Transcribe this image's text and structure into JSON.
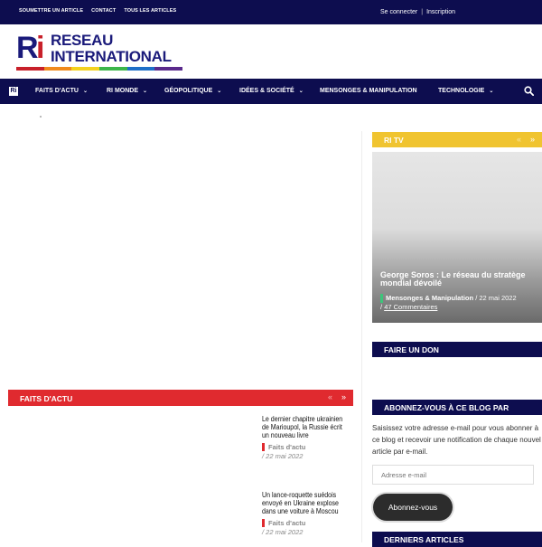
{
  "topbar": {
    "links": [
      "SOUMETTRE UN ARTICLE",
      "CONTACT",
      "TOUS LES ARTICLES"
    ],
    "login": "Se connecter",
    "separator": "|",
    "register": "Inscription"
  },
  "logo": {
    "mark_r": "R",
    "mark_i": "i",
    "line1": "RESEAU",
    "line2": "INTERNATIONAL",
    "stripe_colors": [
      "#c8202a",
      "#f08a1c",
      "#f4d21e",
      "#3cb64a",
      "#1e6fc8",
      "#5a2a8c"
    ]
  },
  "nav": {
    "home_label": "Ri",
    "items": [
      {
        "label": "FAITS D'ACTU",
        "chevron": "⌄"
      },
      {
        "label": "RI MONDE",
        "chevron": "⌄"
      },
      {
        "label": "GÉOPOLITIQUE",
        "chevron": "⌄"
      },
      {
        "label": "IDÉES & SOCIÉTÉ",
        "chevron": "⌄"
      },
      {
        "label": "MENSONGES & MANIPULATION",
        "chevron": ""
      },
      {
        "label": "TECHNOLOGIE",
        "chevron": "⌄"
      }
    ],
    "search_icon": "search-icon"
  },
  "sidebar": {
    "ritv": {
      "title": "RI TV",
      "prev": "«",
      "next": "»",
      "video": {
        "title": "George Soros : Le réseau du stratège mondial dévoilé",
        "category": "Mensonges & Manipulation",
        "date": "/ 22 mai 2022",
        "comments_prefix": "/",
        "comments": "47 Commentaires"
      }
    },
    "don": {
      "title": "FAIRE UN DON"
    },
    "abonnez": {
      "title": "ABONNEZ-VOUS À CE BLOG PAR",
      "text": "Saisissez votre adresse e-mail pour vous abonner à ce blog et recevoir une notification de chaque nouvel article par e-mail.",
      "placeholder": "Adresse e-mail",
      "button": "Abonnez-vous"
    },
    "derniers": {
      "title": "DERNIERS ARTICLES"
    }
  },
  "faits": {
    "title": "FAITS D'ACTU",
    "prev": "«",
    "next": "»",
    "articles": [
      {
        "title": "Le dernier chapitre ukrainien de Marioupol, la Russie écrit un nouveau livre",
        "category": "Faits d'actu",
        "date": "/ 22 mai 2022"
      },
      {
        "title": "Un lance-roquette suédois envoyé en Ukraine explose dans une voiture à Moscou",
        "category": "Faits d'actu",
        "date": "/ 22 mai 2022"
      }
    ]
  }
}
